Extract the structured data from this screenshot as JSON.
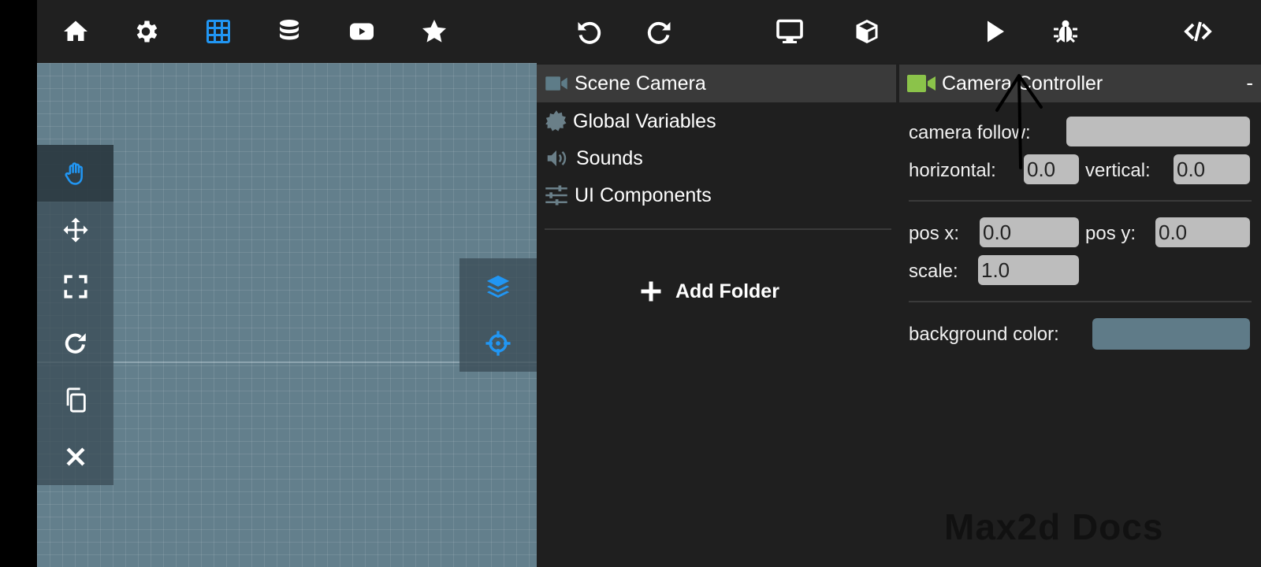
{
  "toolbar": {
    "icons": [
      "home-icon",
      "gear-icon",
      "grid-icon",
      "database-icon",
      "youtube-icon",
      "star-icon",
      "undo-icon",
      "redo-icon",
      "monitor-icon",
      "cube-icon",
      "play-icon",
      "bug-icon",
      "code-icon"
    ],
    "active_color": "#2196f3"
  },
  "canvas": {
    "background_color": "#637f8c",
    "tools": [
      "hand-icon",
      "move-icon",
      "fullscreen-icon",
      "rotate-icon",
      "copy-icon",
      "close-icon"
    ],
    "side_tools": [
      "layers-icon",
      "crosshair-icon"
    ]
  },
  "scene": {
    "items": [
      {
        "label": "Scene Camera",
        "icon": "video-camera-icon",
        "selected": true
      },
      {
        "label": "Global Variables",
        "icon": "gear-badge-icon",
        "selected": false
      },
      {
        "label": "Sounds",
        "icon": "speaker-icon",
        "selected": false
      },
      {
        "label": "UI Components",
        "icon": "sliders-icon",
        "selected": false
      }
    ],
    "add_folder": "Add Folder"
  },
  "inspector": {
    "title": "Camera Controller",
    "collapse": "-",
    "camera_follow_label": "camera follow:",
    "camera_follow_value": "",
    "horizontal_label": "horizontal:",
    "horizontal_value": "0.0",
    "vertical_label": "vertical:",
    "vertical_value": "0.0",
    "pos_x_label": "pos x:",
    "pos_x_value": "0.0",
    "pos_y_label": "pos y:",
    "pos_y_value": "0.0",
    "scale_label": "scale:",
    "scale_value": "1.0",
    "bg_label": "background color:",
    "bg_value": "#5f7b88"
  },
  "watermark": "Max2d Docs"
}
